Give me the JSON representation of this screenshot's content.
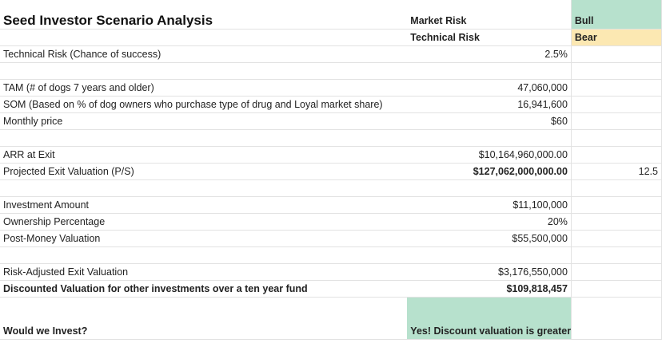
{
  "sheet": {
    "title": "Seed Investor Scenario Analysis",
    "legend": {
      "market_risk_label": "Market Risk",
      "market_risk_tag": "Bull",
      "technical_risk_label": "Technical Risk",
      "technical_risk_tag": "Bear",
      "market_risk_color": "#b7e1cd",
      "technical_risk_color": "#fce8b2"
    },
    "rows": {
      "technical_risk": {
        "label": "Technical Risk (Chance of success)",
        "value": "2.5%"
      },
      "tam": {
        "label": "TAM (# of dogs 7 years and older)",
        "value": "47,060,000"
      },
      "som": {
        "label": "SOM (Based on % of dog owners who purchase type of drug and Loyal market share)",
        "value": "16,941,600"
      },
      "monthly_price": {
        "label": "Monthly price",
        "value": "$60"
      },
      "arr": {
        "label": "ARR at Exit",
        "value": "$10,164,960,000.00"
      },
      "exit_valuation": {
        "label": "Projected Exit Valuation (P/S)",
        "value": "$127,062,000,000.00",
        "multiple": "12.5"
      },
      "investment_amount": {
        "label": "Investment Amount",
        "value": "$11,100,000"
      },
      "ownership": {
        "label": "Ownership Percentage",
        "value": "20%"
      },
      "post_money": {
        "label": "Post-Money Valuation",
        "value": "$55,500,000"
      },
      "risk_adjusted": {
        "label": "Risk-Adjusted Exit Valuation",
        "value": "$3,176,550,000"
      },
      "discounted": {
        "label": "Discounted Valuation for other investments over a ten year fund",
        "value": "$109,818,457"
      },
      "would_invest": {
        "label": "Would we Invest?",
        "value": "Yes! Discount valuation is greater than current post-money valuation."
      }
    }
  }
}
